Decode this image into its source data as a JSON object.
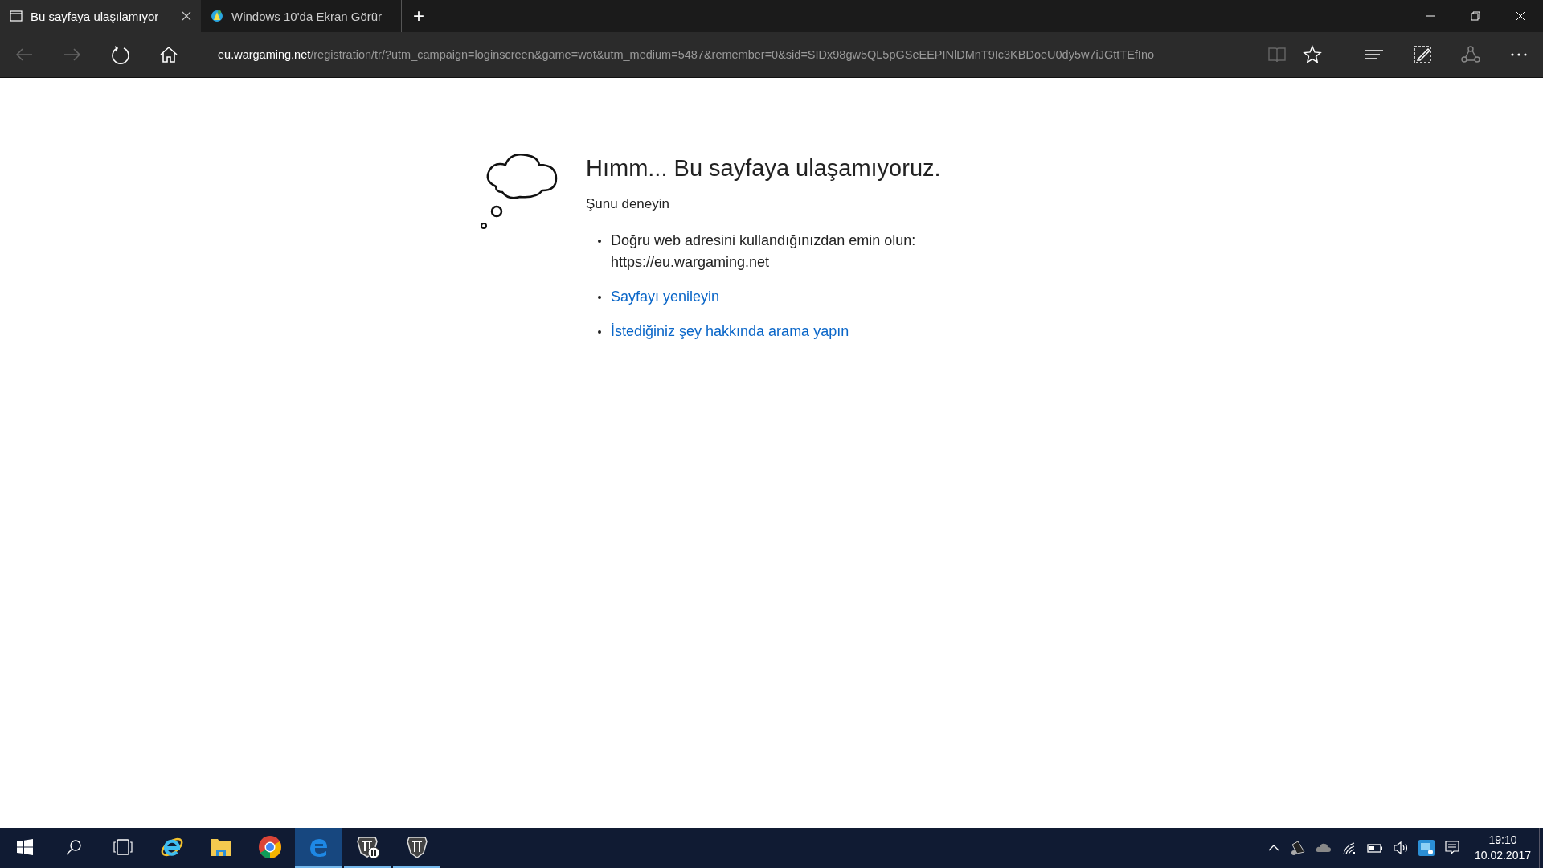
{
  "tabs": [
    {
      "title": "Bu sayfaya ulaşılamıyor",
      "selected": true,
      "kind": "page"
    },
    {
      "title": "Windows 10'da Ekran Görür",
      "selected": false,
      "kind": "site"
    }
  ],
  "new_tab": "+",
  "address_bar": {
    "host": "eu.wargaming.net",
    "path": "/registration/tr/?utm_campaign=loginscreen&game=wot&utm_medium=5487&remember=0&sid=SIDx98gw5QL5pGSeEEPINlDMnT9Ic3KBDoeU0dy5w7iJGttTEfIno"
  },
  "toolbar": {
    "back_disabled": true,
    "forward_disabled": true
  },
  "error": {
    "title": "Hımm... Bu sayfaya ulaşamıyoruz.",
    "subtitle": "Şunu deneyin",
    "suggestions": [
      {
        "kind": "text",
        "lines": [
          "Doğru web adresini kullandığınızdan emin olun:",
          "https://eu.wargaming.net"
        ]
      },
      {
        "kind": "link",
        "lines": [
          "Sayfayı yenileyin"
        ]
      },
      {
        "kind": "link",
        "lines": [
          "İstediğiniz şey hakkında arama yapın"
        ]
      }
    ]
  },
  "taskbar": {
    "apps": [
      {
        "kind": "ie",
        "running": false,
        "active": false
      },
      {
        "kind": "explorer",
        "running": false,
        "active": false
      },
      {
        "kind": "chrome",
        "running": false,
        "active": false
      },
      {
        "kind": "edge",
        "running": true,
        "active": true
      },
      {
        "kind": "wot2",
        "running": true,
        "active": false
      },
      {
        "kind": "wot",
        "running": true,
        "active": false
      }
    ],
    "time": "19:10",
    "date": "10.02.2017"
  }
}
